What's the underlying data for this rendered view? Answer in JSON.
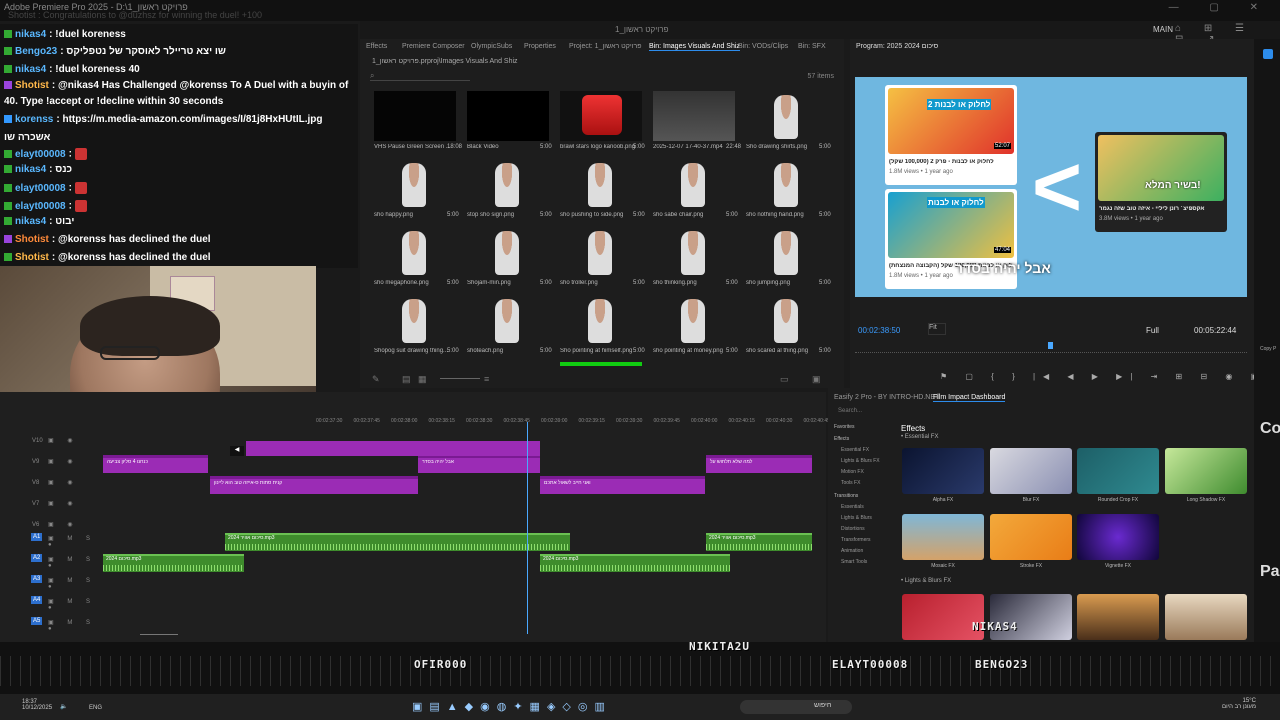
{
  "titlebar": {
    "app": "Adobe Premiere Pro 2025 - D:\\1_פרויקט ראשון",
    "scrolling": "Shotist : Congratulations to @duzhsz for winning the duel! +100",
    "window_controls": "— ▢ ✕"
  },
  "menubar": {
    "project_title": "פרויקט ראשון_1",
    "workspace": "MAIN",
    "icons": "⌂ ⊞ ☰ ⊟ ↗"
  },
  "chat": [
    {
      "user": "nikas4",
      "text": ": !duel koreness",
      "color": "#5ab8ff",
      "badge": "g"
    },
    {
      "user": "Bengo23",
      "text": ": שו יצא טריילר לאוסקר של נטפליקס",
      "color": "#5ab8ff",
      "badge": "g"
    },
    {
      "user": "nikas4",
      "text": ": !duel koreness 40",
      "color": "#5ab8ff",
      "badge": "g"
    },
    {
      "user": "Shotist",
      "text": ": @nikas4 Has Challenged @korenss To A Duel with a buyin of",
      "color": "#ffb84a",
      "badge": "p"
    },
    {
      "user": "",
      "text": "40. Type !accept or !decline within 30 seconds",
      "color": "#fff",
      "badge": ""
    },
    {
      "user": "korenss",
      "text": ": https://m.media-amazon.com/images/I/81j8HxHUtIL.jpg",
      "color": "#5ab8ff",
      "badge": "b"
    },
    {
      "user": "",
      "text": "אשכרה שו",
      "color": "#fff",
      "badge": ""
    },
    {
      "user": "elayt00008",
      "text": ":",
      "color": "#5ab8ff",
      "badge": "g",
      "emote": true
    },
    {
      "user": "nikas4",
      "text": ": כנס",
      "color": "#5ab8ff",
      "badge": "g"
    },
    {
      "user": "elayt00008",
      "text": ":",
      "color": "#5ab8ff",
      "badge": "g",
      "emote": true
    },
    {
      "user": "elayt00008",
      "text": ":",
      "color": "#5ab8ff",
      "badge": "g",
      "emote": true
    },
    {
      "user": "nikas4",
      "text": ": יבוט",
      "color": "#5ab8ff",
      "badge": "g"
    },
    {
      "user": "Shotist",
      "text": ": @korenss has declined the duel",
      "color": "#ff8a3a",
      "badge": "p"
    },
    {
      "user": "Shotist",
      "text": ": @korenss has declined the duel",
      "color": "#ffb84a",
      "badge": "g"
    }
  ],
  "project_panel": {
    "tabs": [
      "Effects",
      "Premiere Composer",
      "OlympicSubs",
      "Properties",
      "Project: 1_פרויקט ראשון",
      "Bin: Images Visuals And Shiz",
      "Bin: VODs/Clips",
      "Bin: SFX"
    ],
    "active_tab": 5,
    "breadcrumb": "1_פרויקט ראשון.prproj\\Images Visuals And Shiz",
    "search_icon": "search-icon",
    "item_count": "57 items",
    "items": [
      {
        "name": "VHS Pause Green Screen ...",
        "dur": "18:08",
        "kind": "dark"
      },
      {
        "name": "Black Video",
        "dur": "5:00",
        "kind": "black"
      },
      {
        "name": "brawl stars logo kanoob.png",
        "dur": "5:00",
        "kind": "logo"
      },
      {
        "name": "2025-12-07 17-40-37.mp4",
        "dur": "22:48",
        "kind": "screen"
      },
      {
        "name": "Sho drawing shirts.png",
        "dur": "5:00",
        "kind": "fig"
      },
      {
        "name": "sho happy.png",
        "dur": "5:00",
        "kind": "fig"
      },
      {
        "name": "stop sho sign.png",
        "dur": "5:00",
        "kind": "fig"
      },
      {
        "name": "sho pushing to side.png",
        "dur": "5:00",
        "kind": "fig"
      },
      {
        "name": "sho sabe chair.png",
        "dur": "5:00",
        "kind": "fig"
      },
      {
        "name": "sho nothing hand.png",
        "dur": "5:00",
        "kind": "fig"
      },
      {
        "name": "sho megaphone.png",
        "dur": "5:00",
        "kind": "fig"
      },
      {
        "name": "Shojam-min.png",
        "dur": "5:00",
        "kind": "fig"
      },
      {
        "name": "sho troller.png",
        "dur": "5:00",
        "kind": "fig"
      },
      {
        "name": "sho thinking.png",
        "dur": "5:00",
        "kind": "fig"
      },
      {
        "name": "sho jumping.png",
        "dur": "5:00",
        "kind": "fig"
      },
      {
        "name": "Shopog suit drawing thing...",
        "dur": "5:00",
        "kind": "fig"
      },
      {
        "name": "shoteach.png",
        "dur": "5:00",
        "kind": "fig"
      },
      {
        "name": "Sho pointing at himself.png",
        "dur": "5:00",
        "kind": "fig"
      },
      {
        "name": "sho pointing at money.png",
        "dur": "5:00",
        "kind": "fig"
      },
      {
        "name": "sho scared al thing.png",
        "dur": "5:00",
        "kind": "fig"
      }
    ]
  },
  "program": {
    "title": "Program: 2025 2024 סיכום",
    "timecode": "00:02:38:50",
    "fit": "Fit",
    "quality": "Full",
    "duration": "00:05:22:44",
    "caption": "אבל יהיה בסדר",
    "card1_title": "לחלוק או לבנות - פרק 2 (100,000 שקל)",
    "card1_meta": "1.8M views • 1 year ago",
    "card2_title": "לחלוק או לבנות 100,000 שקל (הקבוצה המנצחת)",
    "card2_meta": "1.8M views • 1 year ago",
    "card3_title": "אקספיצ׳ רונן ליליי - איזה טוב שזה נגמר",
    "card3_meta": "3.8M views • 1 year ago",
    "card3_badge": "בשיר המלא!",
    "card1_badge": "לחלוק או לבנות 2",
    "card2_badge": "לחלוק או לבנות",
    "dur1": "52:07",
    "dur2": "47:04",
    "ctrls": "⚑ ▢ { } |◀ ◀ ▶ ▶| ⇥ ⊞ ⊟ ◉ ▣ ⊕"
  },
  "timeline": {
    "ruler": [
      "00:02:37:30",
      "00:02:37:45",
      "00:02:38:00",
      "00:02:38:15",
      "00:02:38:30",
      "00:02:38:45",
      "00:02:39:00",
      "00:02:39:15",
      "00:02:39:30",
      "00:02:39:45",
      "00:02:40:00",
      "00:02:40:15",
      "00:02:40:30",
      "00:02:40:45"
    ],
    "tracks": [
      "V10",
      "V9",
      "V8",
      "V7",
      "V6",
      "A1",
      "A2",
      "A3",
      "A4",
      "A5"
    ],
    "video_clips": [
      {
        "label": "כנחנו 4 סליון צביעה",
        "track": 1
      },
      {
        "label": "אבל יהיה בסדר",
        "track": 1
      },
      {
        "label": "למה שלא תלחוש על",
        "track": 1
      },
      {
        "label": "קנית סתות ס-אייזה טוב הוא ליינון",
        "track": 2
      },
      {
        "label": "ואני חייב לשאול אתכם",
        "track": 2
      }
    ],
    "audio_clips": [
      {
        "label": "2024 סיכום אוויר.mp3",
        "track": 5
      },
      {
        "label": "2024 סיכום אוויר.mp3",
        "track": 5
      },
      {
        "label": "2024 סיכום.mp3",
        "track": 6
      },
      {
        "label": "2024 סיכום.mp3",
        "track": 6
      }
    ]
  },
  "effects": {
    "tabs": [
      "Easify 2 Pro - BY INTRO-HD.NET",
      "Film Impact Dashboard"
    ],
    "search": "Search...",
    "header": "Effects",
    "section1": "• Essential FX",
    "section2": "• Lights & Blurs FX",
    "categories": [
      {
        "label": "Favorites",
        "sub": false
      },
      {
        "label": "Effects",
        "sub": false
      },
      {
        "label": "Essential FX",
        "sub": true
      },
      {
        "label": "Lights & Blurs FX",
        "sub": true
      },
      {
        "label": "Motion FX",
        "sub": true
      },
      {
        "label": "Tools FX",
        "sub": true
      },
      {
        "label": "Transitions",
        "sub": false
      },
      {
        "label": "Essentials",
        "sub": true
      },
      {
        "label": "Lights & Blurs",
        "sub": true
      },
      {
        "label": "Distortions",
        "sub": true
      },
      {
        "label": "Transformers",
        "sub": true
      },
      {
        "label": "Animation",
        "sub": true
      },
      {
        "label": "Smart Tools",
        "sub": true
      }
    ],
    "items": [
      {
        "label": "Alpha FX",
        "bg": "linear-gradient(135deg,#0b1430,#2a3a6b)"
      },
      {
        "label": "Blur FX",
        "bg": "linear-gradient(135deg,#d9d9e0,#8a8fb2)"
      },
      {
        "label": "Rounded Crop FX",
        "bg": "linear-gradient(135deg,#1d5f67,#2f8a90)"
      },
      {
        "label": "Long Shadow FX",
        "bg": "linear-gradient(135deg,#c6e89a,#3f8c2f)"
      },
      {
        "label": "Mosaic FX",
        "bg": "linear-gradient(180deg,#7fb7d7,#d4a269)"
      },
      {
        "label": "Stroke FX",
        "bg": "linear-gradient(135deg,#f3a93b,#e97d17)"
      },
      {
        "label": "Vignette FX",
        "bg": "radial-gradient(circle,#6a2ad0,#10063a)"
      },
      {
        "label": "",
        "bg": "linear-gradient(135deg,#b8202e,#e55264)"
      },
      {
        "label": "",
        "bg": "linear-gradient(135deg,#2a2a3a,#d0d0e0)"
      },
      {
        "label": "",
        "bg": "linear-gradient(180deg,#d99b50,#4a2f1a)"
      },
      {
        "label": "",
        "bg": "linear-gradient(180deg,#e8d8c0,#9a7a5a)"
      }
    ]
  },
  "right_edge": {
    "copy": "Copy P",
    "co": "Co",
    "pa": "Pa"
  },
  "bottom": {
    "players": [
      "OFIR000",
      "NIKITA2U",
      "ELAYT00008",
      "BENGO23",
      "NIKAS4"
    ]
  },
  "taskbar": {
    "time": "18:37",
    "date": "10/12/2025",
    "lang": "ENG",
    "search": "חיפוש",
    "weather": "15°C",
    "weather_sub": "מעונן רב היום"
  },
  "colors": {
    "accent": "#2d8ceb",
    "clip_video": "#9b2cb5",
    "clip_audio": "#3e8c2c",
    "playhead": "#4aa8ff"
  }
}
